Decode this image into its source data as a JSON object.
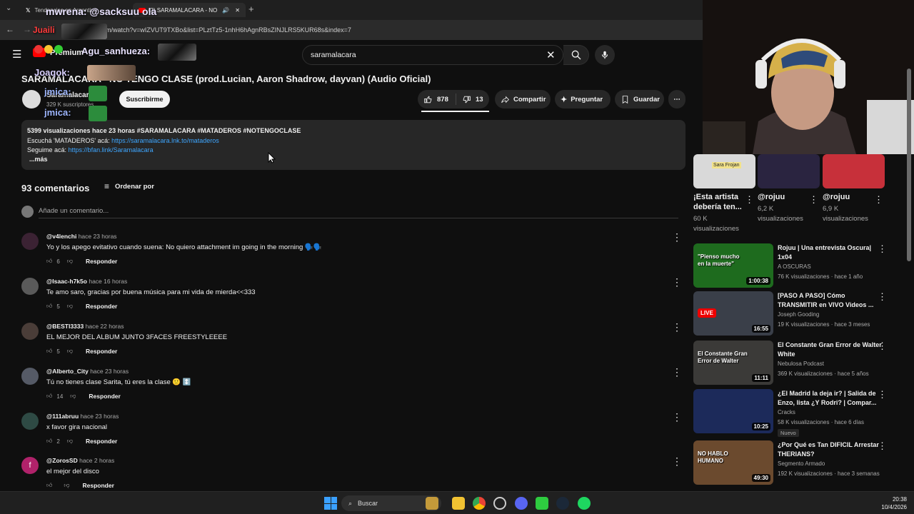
{
  "browser": {
    "tabs": [
      {
        "label": "Tendencias en Argentina"
      },
      {
        "label": "(2) SARAMALACARA - NO T..."
      }
    ],
    "url": "m/watch?v=wIZVUT9TXBo&list=PLztTz5-1nhH6hAgnRBsZINJLRS5KUR68s&index=7"
  },
  "yt": {
    "brand": "Premium",
    "search_value": "saramalacara"
  },
  "overlay_chat": [
    {
      "text": "mwrena: @sacksuu ola"
    },
    {
      "text": "Juaili"
    },
    {
      "text": "Agu_sanhueza:"
    },
    {
      "text": "Joaqok:"
    },
    {
      "text": "jmica:"
    },
    {
      "text": "jmica:"
    }
  ],
  "video": {
    "title": "SARAMALACARA - NO TENGO CLASE (prod.Lucian, Aaron Shadrow, dayvan) (Audio Oficial)",
    "channel": "Saramalacara",
    "subscribers": "329 K suscriptores",
    "subscribe_label": "Suscribirme",
    "likes": "878",
    "dislikes": "13",
    "share_label": "Compartir",
    "ask_label": "Preguntar",
    "save_label": "Guardar"
  },
  "description": {
    "stats": "5399 visualizaciones  hace 23 horas  #SARAMALACARA #MATADEROS #NOTENGOCLASE",
    "line2_prefix": "Escuchá 'MATADEROS' acá: ",
    "line2_link": "https://saramalacara.lnk.to/mataderos",
    "line3_prefix": "Seguime acá: ",
    "line3_link": "https://bfan.link/Saramalacara",
    "more": "...más"
  },
  "comments_section": {
    "count_label": "93 comentarios",
    "sort_label": "Ordenar por",
    "add_placeholder": "Añade un comentario...",
    "reply_label": "Responder",
    "items": [
      {
        "user": "@v4lenchi",
        "time": "hace 23 horas",
        "text": "Yo y los apego evitativo cuando suena: No quiero attachment im going in the morning 🗣️🗣️",
        "likes": "6",
        "avatar_color": "#3b2233"
      },
      {
        "user": "@Isaac-h7k5o",
        "time": "hace 16 horas",
        "text": "Te amo saro, gracias por buena música para mi vida de mierda<<333",
        "likes": "5",
        "avatar_color": "#5a5a5a"
      },
      {
        "user": "@BESTI3333",
        "time": "hace 22 horas",
        "text": "EL MEJOR DEL ALBUM JUNTO 3FACES FREESTYLEEEE",
        "likes": "5",
        "avatar_color": "#4a3d38"
      },
      {
        "user": "@Alberto_City",
        "time": "hace 23 horas",
        "text": "Tú no tienes clase Sarita, tú eres la clase 🙂 ↕️",
        "likes": "14",
        "avatar_color": "#555a66"
      },
      {
        "user": "@111abruu",
        "time": "hace 23 horas",
        "text": "x favor gira nacional",
        "likes": "2",
        "avatar_color": "#2e4a44"
      },
      {
        "user": "@ZorosSD",
        "time": "hace 2 horas",
        "text": "el mejor del disco",
        "likes": "",
        "avatar_color": "#b0226a",
        "avatar_letter": "f"
      }
    ]
  },
  "shorts": [
    {
      "title": "¡Esta artista debería ten...",
      "views": "60 K visualizaciones",
      "thumb_label": "Sara Frojan"
    },
    {
      "title": "@rojuu",
      "views": "6,2 K visualizaciones"
    },
    {
      "title": "@rojuu",
      "views": "6,9 K visualizaciones"
    }
  ],
  "recommended": [
    {
      "title": "Rojuu | Una entrevista Oscura| 1x04",
      "channel": "A OSCURAS",
      "details": "76 K visualizaciones · hace 1 año",
      "duration": "1:00:38",
      "thumb_text": "\"Pienso mucho en la muerte\"",
      "thumb_color": "#1e6b1e"
    },
    {
      "title": "[PASO A PASO] Cómo TRANSMITIR en VIVO Videos ...",
      "channel": "Joseph Gooding",
      "details": "19 K visualizaciones · hace 3 meses",
      "duration": "16:55",
      "thumb_text": "LIVE",
      "thumb_color": "#3a3f49"
    },
    {
      "title": "El Constante Gran Error de Walter White",
      "channel": "Nebulosa Podcast",
      "details": "369 K visualizaciones · hace 5 años",
      "duration": "11:11",
      "thumb_text": "El Constante Gran Error de Walter",
      "thumb_color": "#3b3a38"
    },
    {
      "title": "¿El Madrid la deja ir? | Salida de Enzo, lista ¿Y Rodri? | Compar...",
      "channel": "Cracks",
      "details": "58 K visualizaciones · hace 6 días",
      "duration": "10:25",
      "badge": "Nuevo",
      "thumb_color": "#1c2a5a"
    },
    {
      "title": "¿Por Qué es Tan DIFICIL Arrestar THERIANS?",
      "channel": "Segmento Armado",
      "details": "192 K visualizaciones · hace 3 semanas",
      "duration": "49:30",
      "thumb_text": "NO HABLO HUMANO",
      "thumb_color": "#6b4a2e"
    }
  ],
  "taskbar": {
    "search_label": "Buscar",
    "time": "20:38",
    "date": "10/4/2026"
  }
}
